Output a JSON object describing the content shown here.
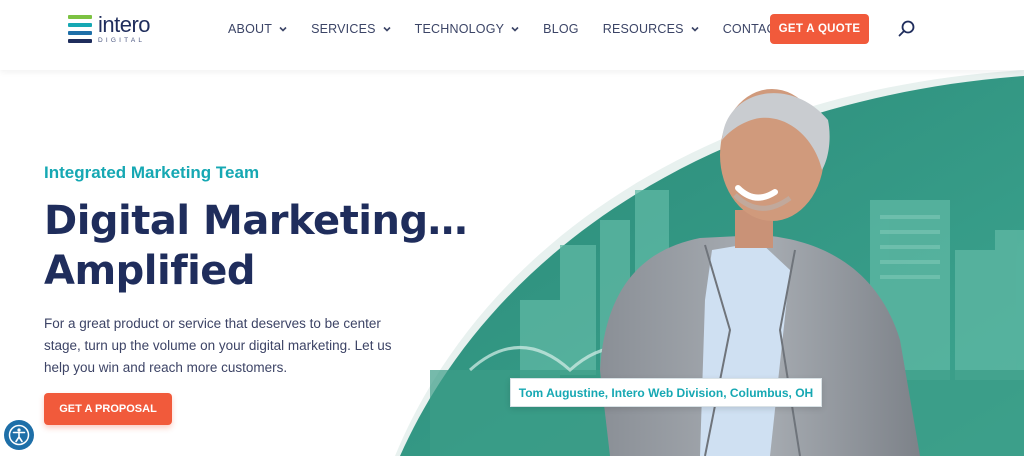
{
  "brand": {
    "name": "intero",
    "subname": "DIGITAL",
    "colors": {
      "navy": "#1f2d5c",
      "teal": "#16a8b3",
      "orange": "#f15a3b",
      "green": "#2f8f7d"
    }
  },
  "nav": {
    "items": [
      {
        "label": "ABOUT",
        "has_dropdown": true
      },
      {
        "label": "SERVICES",
        "has_dropdown": true
      },
      {
        "label": "TECHNOLOGY",
        "has_dropdown": true
      },
      {
        "label": "BLOG",
        "has_dropdown": false
      },
      {
        "label": "RESOURCES",
        "has_dropdown": true
      },
      {
        "label": "CONTACT US",
        "has_dropdown": false
      }
    ],
    "cta_label": "GET A QUOTE",
    "search_icon": "search-icon"
  },
  "hero": {
    "eyebrow": "Integrated Marketing Team",
    "headline_line1": "Digital Marketing…",
    "headline_line2": "Amplified",
    "body": "For a great product or service that deserves to be center stage, turn up the volume on your digital marketing. Let us help you win and reach more customers.",
    "cta_label": "GET A PROPOSAL",
    "caption": "Tom Augustine, Intero Web Division, Columbus, OH"
  },
  "accessibility": {
    "icon": "accessibility-icon"
  }
}
